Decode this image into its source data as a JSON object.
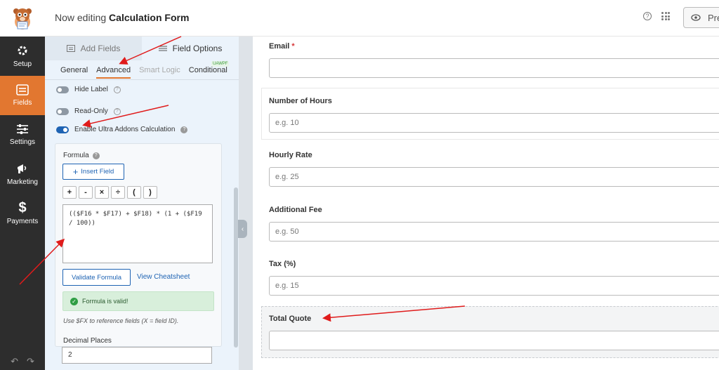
{
  "header": {
    "editing_prefix": "Now editing",
    "form_name": "Calculation Form",
    "preview_label": "Pre"
  },
  "nav": [
    {
      "label": "Setup",
      "icon": "gear-icon"
    },
    {
      "label": "Fields",
      "icon": "list-icon",
      "active": true
    },
    {
      "label": "Settings",
      "icon": "sliders-icon"
    },
    {
      "label": "Marketing",
      "icon": "megaphone-icon"
    },
    {
      "label": "Payments",
      "icon": "dollar-icon"
    }
  ],
  "panel": {
    "tabs": [
      "Add Fields",
      "Field Options"
    ],
    "subtabs": [
      "General",
      "Advanced",
      "Smart Logic",
      "Conditional"
    ],
    "uawpf_badge": "UAWPF",
    "hide_label": "Hide Label",
    "read_only": "Read-Only",
    "enable_calc": "Enable Ultra Addons Calculation",
    "formula_label": "Formula",
    "insert_field": "Insert Field",
    "operators": [
      "+",
      "-",
      "×",
      "÷",
      "(",
      ")"
    ],
    "formula_value": "(($F16 * $F17) + $F18) * (1 + ($F19 / 100))",
    "validate_label": "Validate Formula",
    "cheatsheet_label": "View Cheatsheet",
    "valid_message": "Formula is valid!",
    "hint": "Use $FX to reference fields (X = field ID).",
    "decimal_label": "Decimal Places",
    "decimal_value": "2"
  },
  "form": {
    "fields": [
      {
        "label": "Email",
        "required": "*",
        "placeholder": ""
      },
      {
        "label": "Number of Hours",
        "placeholder": "e.g. 10"
      },
      {
        "label": "Hourly Rate",
        "placeholder": "e.g. 25"
      },
      {
        "label": "Additional Fee",
        "placeholder": "e.g. 50"
      },
      {
        "label": "Tax (%)",
        "placeholder": "e.g. 15"
      },
      {
        "label": "Total Quote",
        "placeholder": ""
      }
    ]
  },
  "colors": {
    "accent": "#e27730",
    "nav_bg": "#2d2d2d",
    "blue": "#1e63b3",
    "arrow": "#e01b1b"
  }
}
